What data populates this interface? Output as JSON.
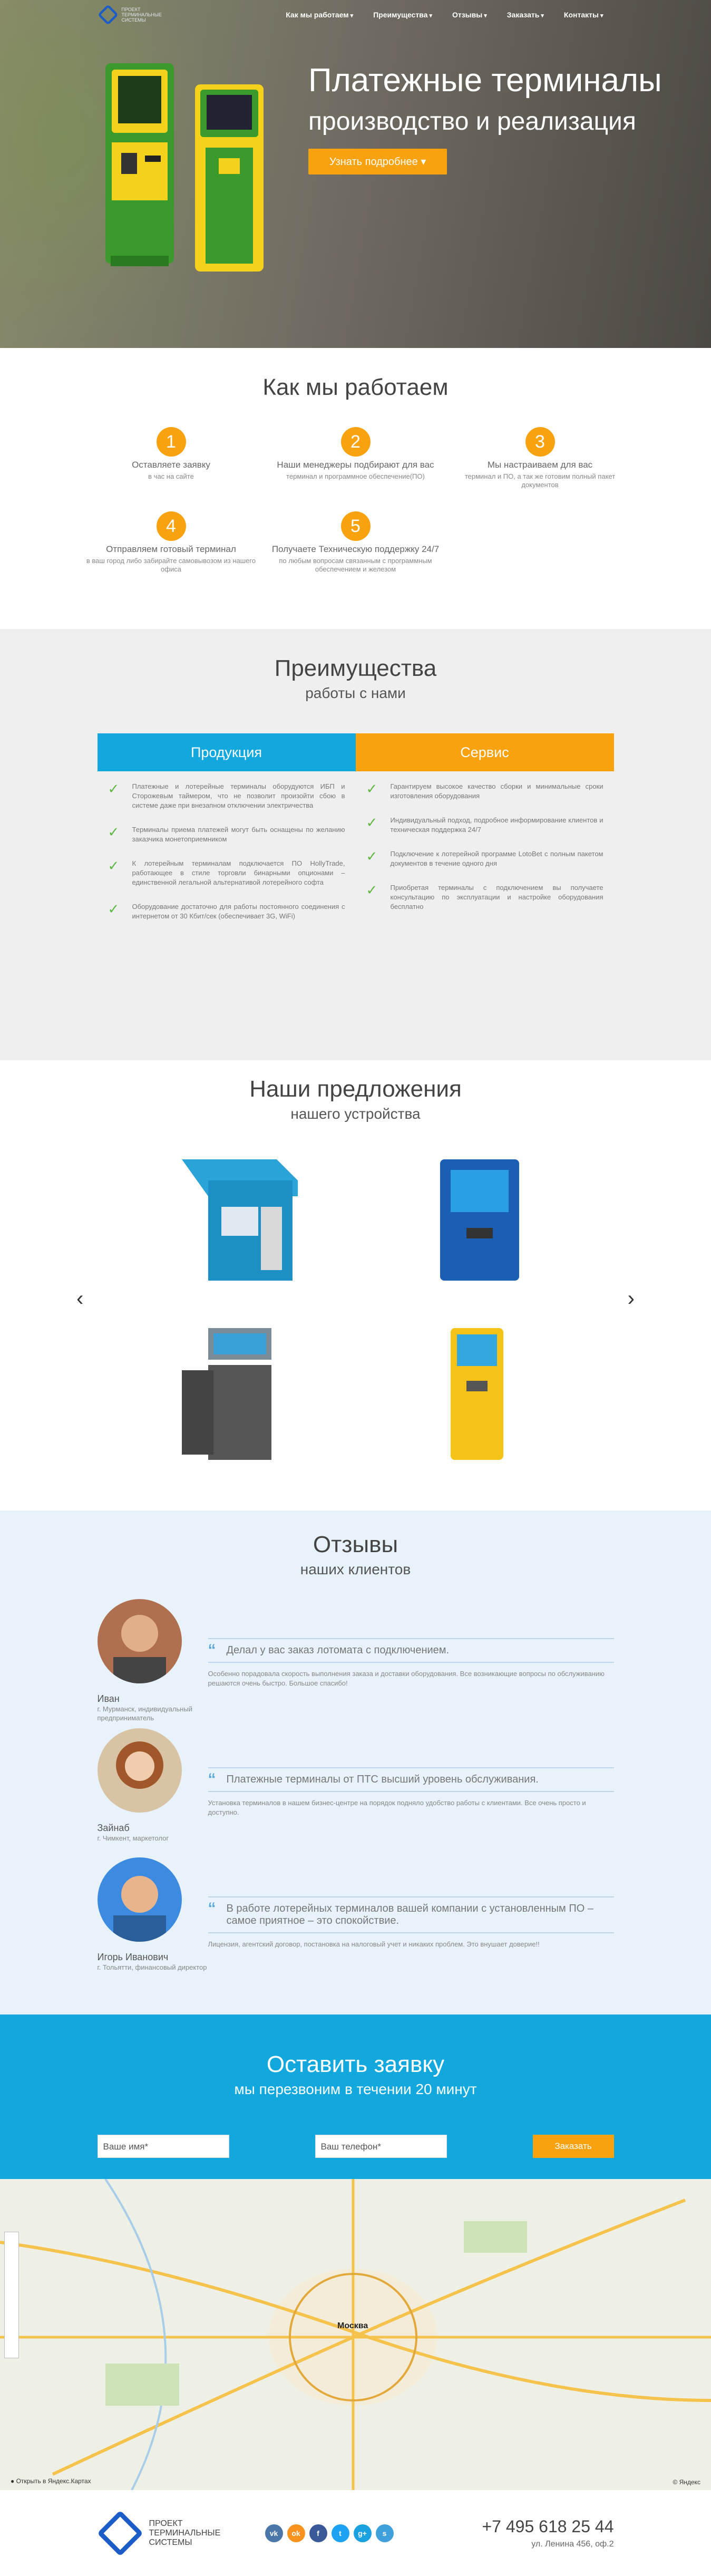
{
  "nav": {
    "logo_text": "ПРОЕКТ ТЕРМИНАЛЬНЫЕ СИСТЕМЫ",
    "items": [
      "Как мы работаем",
      "Преимущества",
      "Отзывы",
      "Заказать",
      "Контакты"
    ]
  },
  "hero": {
    "title": "Платежные терминалы",
    "subtitle": "производство и реализация",
    "button": "Узнать подробнее"
  },
  "how": {
    "title": "Как мы работаем",
    "steps": [
      {
        "num": "1",
        "title": "Оставляете заявку",
        "desc": "в час на сайте"
      },
      {
        "num": "2",
        "title": "Наши менеджеры подбирают для вас",
        "desc": "терминал и программное обеспечение(ПО)"
      },
      {
        "num": "3",
        "title": "Мы настраиваем для вас",
        "desc": "терминал и ПО, а так же готовим полный пакет документов"
      },
      {
        "num": "4",
        "title": "Отправляем готовый терминал",
        "desc": "в ваш город либо забирайте самовывозом из нашего офиса"
      },
      {
        "num": "5",
        "title": "Получаете Техническую поддержку 24/7",
        "desc": "по любым вопросам связанным с программным обеспечением и железом"
      }
    ]
  },
  "advantages": {
    "title": "Преимущества",
    "subtitle": "работы с нами",
    "tab_products": "Продукция",
    "tab_service": "Сервис",
    "products": [
      "Платежные и лотерейные терминалы оборудуются ИБП и Сторожевым таймером, что не позволит произойти сбою в системе даже при внезапном отключении электричества",
      "Терминалы приема платежей могут быть оснащены по желанию заказчика монетоприемником",
      "К лотерейным терминалам подключается ПО HollyTrade, работающее в стиле торговли бинарными опционами – единственной легальной альтернативой лотерейного софта",
      "Оборудование достаточно для работы постоянного соединения с интернетом от 30 Кбит/сек (обеспечивает 3G, WiFi)"
    ],
    "service": [
      "Гарантируем высокое качество сборки и минимальные сроки изготовления оборудования",
      "Индивидуальный подход, подробное информирование клиентов и техническая поддержка 24/7",
      "Подключение к лотерейной программе LotoBet с полным пакетом документов в течение одного дня",
      "Приобретая терминалы с подключением вы получаете консультацию по эксплуатации и настройке оборудования бесплатно"
    ]
  },
  "offers": {
    "title": "Наши предложения",
    "subtitle": "нашего устройства"
  },
  "reviews": {
    "title": "Отзывы",
    "subtitle": "наших клиентов",
    "items": [
      {
        "name": "Иван",
        "role": "г. Мурманск, индивидуальный предприниматель",
        "quote": "Делал у вас заказ лотомата с подключением.",
        "text": "Особенно порадовала скорость выполнения заказа и доставки оборудования. Все возникающие вопросы по обслуживанию решаются очень быстро. Большое спасибо!"
      },
      {
        "name": "Зайнаб",
        "role": "г. Чимкент, маркетолог",
        "quote": "Платежные терминалы от ПТС высший уровень обслуживания.",
        "text": "Установка терминалов в нашем бизнес-центре на порядок подняло удобство работы с клиентами. Все очень просто и доступно."
      },
      {
        "name": "Игорь Иванович",
        "role": "г. Тольятти, финансовый директор",
        "quote": "В работе лотерейных терминалов вашей компании с установленным ПО – самое приятное – это спокойствие.",
        "text": "Лицензия, агентский договор, постановка на налоговый учет и никаких проблем. Это внушает доверие!!"
      }
    ]
  },
  "form": {
    "title": "Оставить заявку",
    "subtitle": "мы перезвоним в течении 20 минут",
    "name_placeholder": "Ваше имя*",
    "phone_placeholder": "Ваш телефон*",
    "submit": "Заказать"
  },
  "map": {
    "city": "Москва",
    "open_link": "Открыть в Яндекс.Картах",
    "brand": "© Яндекс"
  },
  "footer": {
    "logo_text": "ПРОЕКТ ТЕРМИНАЛЬНЫЕ СИСТЕМЫ",
    "phone": "+7 495 618 25 44",
    "address": "ул. Ленина 456, оф.2",
    "social": [
      {
        "icon": "vk-icon",
        "glyph": "vk",
        "color": "#4a76a8"
      },
      {
        "icon": "ok-icon",
        "glyph": "ok",
        "color": "#f7931e"
      },
      {
        "icon": "facebook-icon",
        "glyph": "f",
        "color": "#3b5998"
      },
      {
        "icon": "twitter-icon",
        "glyph": "t",
        "color": "#1da1f2"
      },
      {
        "icon": "googleplus-icon",
        "glyph": "g+",
        "color": "#1aa1e0"
      },
      {
        "icon": "skype-icon",
        "glyph": "s",
        "color": "#3fa0dc"
      }
    ]
  },
  "colors": {
    "accent_orange": "#f7a20e",
    "accent_blue": "#12a8de",
    "brand_blue": "#1b5cc7",
    "check_green": "#5eb844"
  }
}
